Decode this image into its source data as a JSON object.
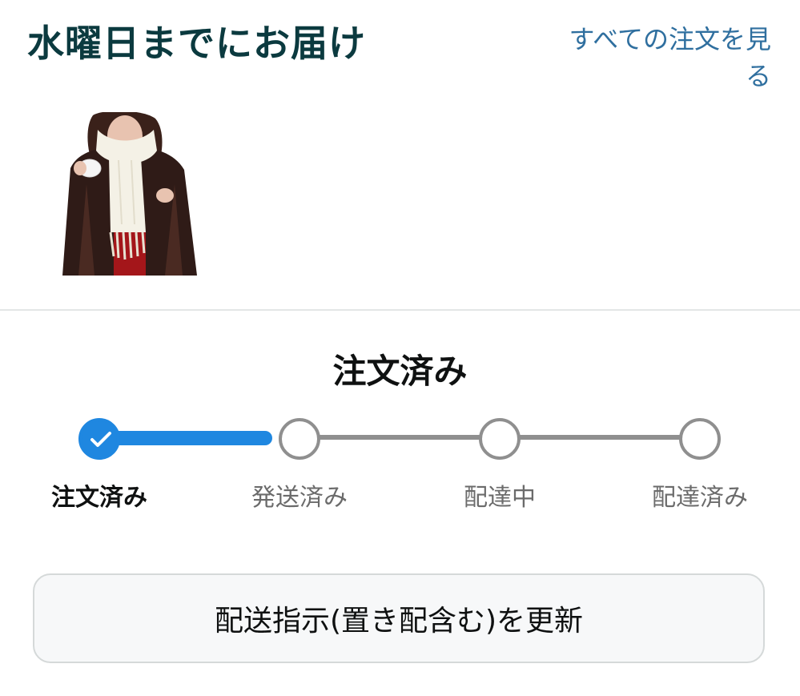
{
  "header": {
    "delivery_title": "水曜日までにお届け",
    "view_all_link": "すべての注文を見る"
  },
  "status": {
    "title": "注文済み",
    "current_step": 1,
    "steps": [
      {
        "label": "注文済み",
        "done": true
      },
      {
        "label": "発送済み",
        "done": false
      },
      {
        "label": "配達中",
        "done": false
      },
      {
        "label": "配達済み",
        "done": false
      }
    ]
  },
  "actions": {
    "update_delivery_button": "配送指示(置き配含む)を更新"
  },
  "colors": {
    "progress_accent": "#1f87e0",
    "title_color": "#0b3a3f",
    "link_color": "#2f6f9f"
  },
  "icons": {
    "step_done": "check-icon"
  }
}
